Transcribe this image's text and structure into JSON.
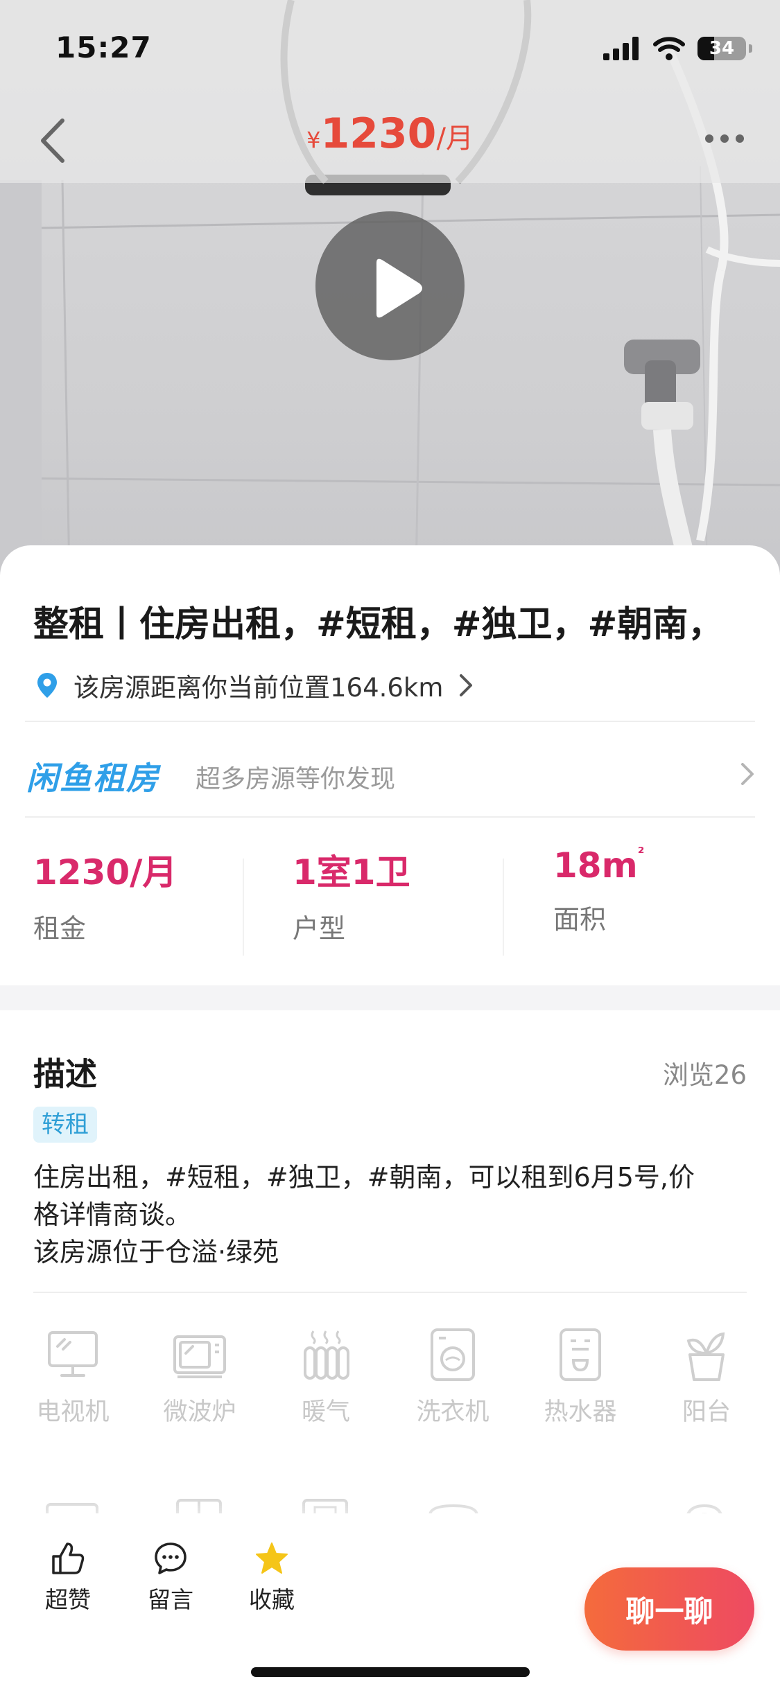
{
  "status_bar": {
    "time": "15:27",
    "battery": "34",
    "battery_level": 0.34
  },
  "header": {
    "price_currency": "¥",
    "price_value": "1230",
    "price_unit": "/月",
    "back_icon": "chevron-left-icon",
    "more_icon": "more-horizontal-icon"
  },
  "media": {
    "play_icon": "play-icon"
  },
  "listing": {
    "title": "整租丨住房出租，#短租，#独卫，#朝南，",
    "distance": "该房源距离你当前位置164.6km"
  },
  "promo": {
    "brand": "闲鱼租房",
    "slogan": "超多房源等你发现"
  },
  "stats": [
    {
      "value": "1230/月",
      "label": "租金"
    },
    {
      "value": "1室1卫",
      "label": "户型"
    },
    {
      "value": "18m",
      "sup": "²",
      "label": "面积"
    }
  ],
  "description": {
    "heading": "描述",
    "views": "浏览26",
    "tag": "转租",
    "lines": [
      "住房出租，#短租，#独卫，#朝南，可以租到6月5号,价",
      "格详情商谈。",
      "该房源位于仓溢·绿苑"
    ]
  },
  "amenities": [
    {
      "name": "电视机",
      "icon": "tv-icon"
    },
    {
      "name": "微波炉",
      "icon": "microwave-icon"
    },
    {
      "name": "暖气",
      "icon": "radiator-icon"
    },
    {
      "name": "洗衣机",
      "icon": "washing-machine-icon"
    },
    {
      "name": "热水器",
      "icon": "water-heater-icon"
    },
    {
      "name": "阳台",
      "icon": "balcony-plant-icon"
    }
  ],
  "bottom_bar": {
    "like": "超赞",
    "comment": "留言",
    "favorite": "收藏",
    "chat": "聊一聊"
  },
  "colors": {
    "price": "#e64a3b",
    "stat_value": "#d9296a",
    "brand": "#2f9fe8",
    "chat_start": "#f46b3c",
    "chat_end": "#ee4a62",
    "star": "#f5c518"
  }
}
